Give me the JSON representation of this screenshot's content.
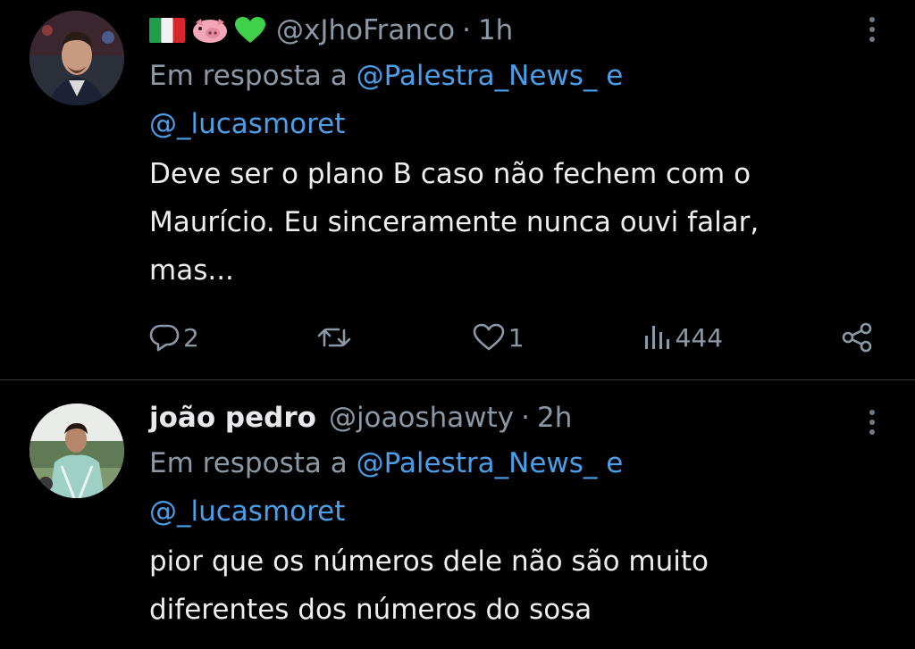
{
  "tweets": [
    {
      "flags": [
        "italy-flag-icon",
        "pig-face-icon",
        "green-heart-icon"
      ],
      "name": "",
      "handle": "@xJhoFranco",
      "dot": "·",
      "time": "1h",
      "replying_prefix": "Em resposta a",
      "mention1": "@Palestra_News_",
      "joiner": "e",
      "mention2": "@_lucasmoret",
      "text_lines": [
        "Deve ser o plano B caso não fechem com o",
        "Maurício. Eu sinceramente nunca ouvi falar,",
        "mas..."
      ],
      "replies": "2",
      "retweets": "",
      "likes": "1",
      "views": "444"
    },
    {
      "name": "joão pedro",
      "handle": "@joaoshawty",
      "dot": "·",
      "time": "2h",
      "replying_prefix": "Em resposta a",
      "mention1": "@Palestra_News_",
      "joiner": "e",
      "mention2": "@_lucasmoret",
      "text_lines": [
        "pior que os números dele não são muito",
        "diferentes dos números do sosa"
      ]
    }
  ],
  "colors": {
    "background": "#000000",
    "text": "#e7e9ea",
    "secondary": "#8b98a5",
    "link": "#4a9fe8",
    "divider": "#2f3336"
  }
}
